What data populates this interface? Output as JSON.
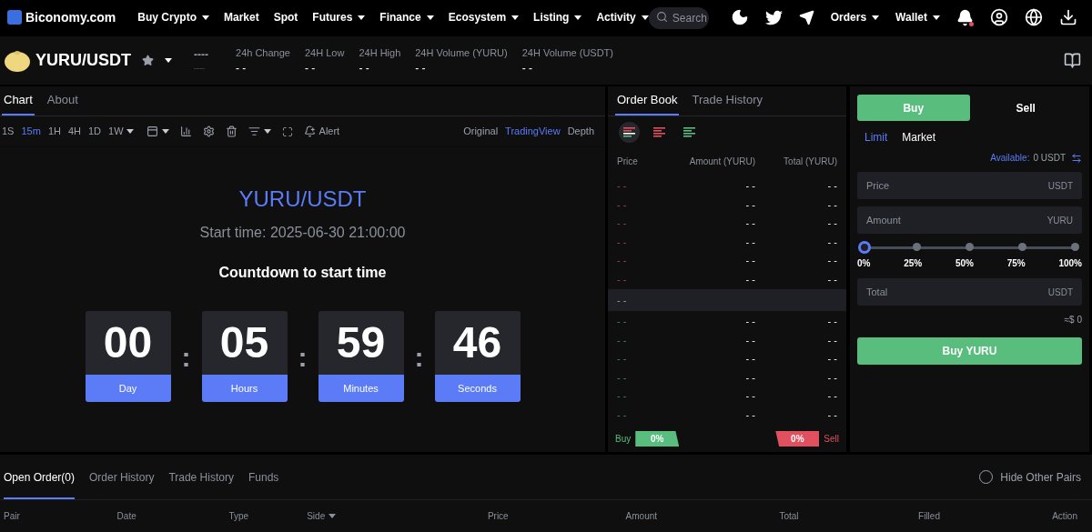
{
  "nav": {
    "logo": "Biconomy.com",
    "menu": [
      {
        "label": "Buy Crypto",
        "caret": true
      },
      {
        "label": "Market",
        "caret": false
      },
      {
        "label": "Spot",
        "caret": false
      },
      {
        "label": "Futures",
        "caret": true
      },
      {
        "label": "Finance",
        "caret": true
      },
      {
        "label": "Ecosystem",
        "caret": true
      },
      {
        "label": "Listing",
        "caret": true
      },
      {
        "label": "Activity",
        "caret": true
      }
    ],
    "search": {
      "placeholder": "Search"
    },
    "right_menu": [
      {
        "label": "Orders",
        "caret": true
      },
      {
        "label": "Wallet",
        "caret": true
      }
    ],
    "notification_dot": true
  },
  "pair": {
    "name": "YURU/USDT",
    "favorite": false,
    "price": "----",
    "price_sub": "----",
    "stats": [
      {
        "label": "24h Change",
        "value": "- -"
      },
      {
        "label": "24H Low",
        "value": "- -"
      },
      {
        "label": "24H High",
        "value": "- -"
      },
      {
        "label": "24H Volume (YURU)",
        "value": "- -"
      },
      {
        "label": "24H Volume (USDT)",
        "value": "- -"
      }
    ]
  },
  "chart_panel": {
    "tabs": [
      {
        "label": "Chart",
        "selected": true
      },
      {
        "label": "About",
        "selected": false
      }
    ],
    "intervals": [
      {
        "label": "1S",
        "selected": false,
        "caret": false
      },
      {
        "label": "15m",
        "selected": true,
        "caret": false
      },
      {
        "label": "1H",
        "selected": false,
        "caret": false
      },
      {
        "label": "4H",
        "selected": false,
        "caret": false
      },
      {
        "label": "1D",
        "selected": false,
        "caret": false
      },
      {
        "label": "1W",
        "selected": false,
        "caret": true
      }
    ],
    "alert": "Alert",
    "views": [
      {
        "label": "Original",
        "selected": false
      },
      {
        "label": "TradingView",
        "selected": true
      },
      {
        "label": "Depth",
        "selected": false
      }
    ],
    "title": "YURU/USDT",
    "start_time": "Start time: 2025-06-30 21:00:00",
    "countdown_label": "Countdown to start time",
    "countdown": [
      {
        "value": "00",
        "unit": "Day"
      },
      {
        "value": "05",
        "unit": "Hours"
      },
      {
        "value": "59",
        "unit": "Minutes"
      },
      {
        "value": "46",
        "unit": "Seconds"
      }
    ],
    "separator": ":"
  },
  "order_book": {
    "tabs": [
      {
        "label": "Order Book",
        "selected": true
      },
      {
        "label": "Trade History",
        "selected": false
      }
    ],
    "layouts": [
      {
        "kind": "both",
        "selected": true
      },
      {
        "kind": "sell",
        "selected": false
      },
      {
        "kind": "buy",
        "selected": false
      }
    ],
    "columns": [
      "Price",
      "Amount (YURU)",
      "Total (YURU)"
    ],
    "asks": [
      {
        "price": "- -",
        "amount": "- -",
        "total": "- -"
      },
      {
        "price": "- -",
        "amount": "- -",
        "total": "- -"
      },
      {
        "price": "- -",
        "amount": "- -",
        "total": "- -"
      },
      {
        "price": "- -",
        "amount": "- -",
        "total": "- -"
      },
      {
        "price": "- -",
        "amount": "- -",
        "total": "- -"
      },
      {
        "price": "- -",
        "amount": "- -",
        "total": "- -"
      }
    ],
    "mid_price": "- -",
    "bids": [
      {
        "price": "- -",
        "amount": "- -",
        "total": "- -"
      },
      {
        "price": "- -",
        "amount": "- -",
        "total": "- -"
      },
      {
        "price": "- -",
        "amount": "- -",
        "total": "- -"
      },
      {
        "price": "- -",
        "amount": "- -",
        "total": "- -"
      },
      {
        "price": "- -",
        "amount": "- -",
        "total": "- -"
      },
      {
        "price": "- -",
        "amount": "- -",
        "total": "- -"
      }
    ],
    "buy_label": "Buy",
    "buy_ratio": "0%",
    "sell_ratio": "0%",
    "sell_label": "Sell"
  },
  "trade": {
    "sides": [
      {
        "label": "Buy",
        "selected": true
      },
      {
        "label": "Sell",
        "selected": false
      }
    ],
    "order_types": [
      {
        "label": "Limit",
        "selected": true
      },
      {
        "label": "Market",
        "selected": false
      }
    ],
    "available_label": "Available:",
    "available_value": "0 USDT",
    "price_field": {
      "placeholder": "Price",
      "unit": "USDT"
    },
    "amount_field": {
      "placeholder": "Amount",
      "unit": "YURU"
    },
    "slider": {
      "level": 0,
      "marks": [
        "0%",
        "25%",
        "50%",
        "75%",
        "100%"
      ]
    },
    "total_field": {
      "placeholder": "Total",
      "unit": "USDT"
    },
    "estimate": "≈$ 0",
    "submit": "Buy YURU"
  },
  "orders": {
    "tabs": [
      {
        "label": "Open Order(0)",
        "selected": true
      },
      {
        "label": "Order History",
        "selected": false
      },
      {
        "label": "Trade History",
        "selected": false
      },
      {
        "label": "Funds",
        "selected": false
      }
    ],
    "hide_other_pairs": {
      "label": "Hide Other Pairs",
      "checked": false
    },
    "columns": [
      {
        "label": "Pair",
        "caret": false
      },
      {
        "label": "Date",
        "caret": false
      },
      {
        "label": "Type",
        "caret": false
      },
      {
        "label": "Side",
        "caret": true
      },
      {
        "label": "Price",
        "caret": false
      },
      {
        "label": "Amount",
        "caret": false
      },
      {
        "label": "Total",
        "caret": false
      },
      {
        "label": "Filled",
        "caret": false
      },
      {
        "label": "Action",
        "caret": false
      }
    ]
  }
}
